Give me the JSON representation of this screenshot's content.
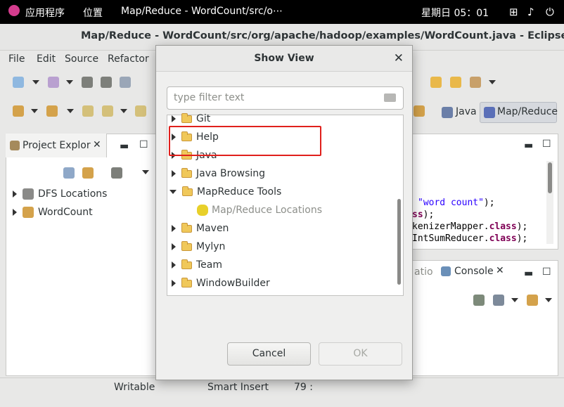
{
  "topbar": {
    "apps": "应用程序",
    "places": "位置",
    "window": "Map/Reduce - WordCount/src/o⋯",
    "clock": "星期日 05：01"
  },
  "window": {
    "title": "Map/Reduce - WordCount/src/org/apache/hadoop/examples/WordCount.java - Eclipse"
  },
  "menu": [
    "File",
    "Edit",
    "Source",
    "Refactor"
  ],
  "perspectives": {
    "java": "Java",
    "mapreduce": "Map/Reduce"
  },
  "explorer": {
    "tab": "Project Explor",
    "items": [
      "DFS Locations",
      "WordCount"
    ]
  },
  "editor": {
    "lines": [
      {
        "a": "\"word count\"",
        "b": ");"
      },
      {
        "a": "ss",
        "b": ");"
      },
      {
        "a": "kenizerMapper.",
        "b": "class",
        "c": ");"
      },
      {
        "a": "IntSumReducer.",
        "b": "class",
        "c": ");"
      }
    ]
  },
  "console": {
    "tab": "Console",
    "left_tab": "atio"
  },
  "status": {
    "writable": "Writable",
    "insert": "Smart Insert",
    "pos": "79 :"
  },
  "dialog": {
    "title": "Show View",
    "filter_placeholder": "type filter text",
    "items": [
      {
        "label": "Git",
        "expanded": false
      },
      {
        "label": "Help",
        "expanded": false
      },
      {
        "label": "Java",
        "expanded": false
      },
      {
        "label": "Java Browsing",
        "expanded": false
      },
      {
        "label": "MapReduce Tools",
        "expanded": true
      },
      {
        "label": "Map/Reduce Locations",
        "child": true
      },
      {
        "label": "Maven",
        "expanded": false
      },
      {
        "label": "Mylyn",
        "expanded": false
      },
      {
        "label": "Team",
        "expanded": false
      },
      {
        "label": "WindowBuilder",
        "expanded": false
      }
    ],
    "cancel": "Cancel",
    "ok": "OK"
  },
  "colors": {
    "highlight": "#e0201c",
    "topbar": "#000000"
  }
}
